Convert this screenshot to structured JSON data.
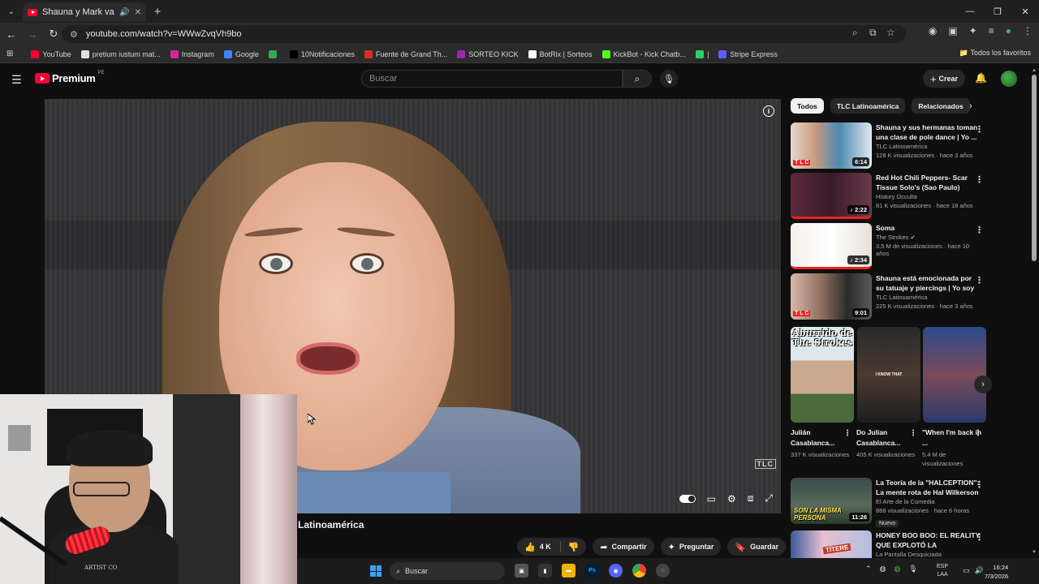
{
  "browser": {
    "tab_title": "Shauna y Mark van al gimn",
    "url": "youtube.com/watch?v=WWwZvqVh9bo",
    "bookmarks": [
      {
        "label": "YouTube",
        "color": "#ff0033"
      },
      {
        "label": "pretium iustum mat...",
        "color": "#e0e0e0"
      },
      {
        "label": "Instagram",
        "color": "#d6249f"
      },
      {
        "label": "Google",
        "color": "#4285f4"
      },
      {
        "label": "",
        "color": "#34a853"
      },
      {
        "label": "10Notificaciones",
        "color": "#000000"
      },
      {
        "label": "Fuente de Grand Th...",
        "color": "#d93025"
      },
      {
        "label": "SORTEO KICK",
        "color": "#9c27b0"
      },
      {
        "label": "BotRix | Sorteos",
        "color": "#ffffff"
      },
      {
        "label": "KickBot - Kick Chatb...",
        "color": "#53fc18"
      },
      {
        "label": "|",
        "color": "#25d366"
      },
      {
        "label": "Stripe Express",
        "color": "#635bff"
      }
    ],
    "all_bookmarks": "Todos los favoritos"
  },
  "header": {
    "logo_text": "Premium",
    "region": "PE",
    "search_placeholder": "Buscar",
    "create_label": "Crear"
  },
  "player": {
    "watermark": "TLC"
  },
  "video": {
    "channel_partial": "Latinoamérica",
    "likes": "4 K",
    "share": "Compartir",
    "ask": "Preguntar",
    "save": "Guardar"
  },
  "chips": [
    "Todos",
    "TLC Latinoamérica",
    "Relacionados"
  ],
  "recommendations": [
    {
      "title": "Shauna y sus hermanas toman una clase de pole dance | Yo ...",
      "channel": "TLC Latinoamérica",
      "stats": "128 K visualizaciones · hace 3 años",
      "duration": "6:14",
      "verified": false
    },
    {
      "title": "Red Hot Chili Peppers- Scar Tissue Solo's (Sao Paulo)",
      "channel": "History Occulta",
      "stats": "81 K visualizaciones · hace 18 años",
      "duration": "♪ 2:22",
      "verified": false
    },
    {
      "title": "Soma",
      "channel": "The Strokes",
      "stats": "3,5 M de visualizaciones · hace 10 años",
      "duration": "♪ 2:34",
      "verified": true
    },
    {
      "title": "Shauna está emocionada por su tatuaje y piercings | Yo soy ...",
      "channel": "TLC Latinoamérica",
      "stats": "225 K visualizaciones · hace 3 años",
      "duration": "9:01",
      "verified": false
    }
  ],
  "shorts": [
    {
      "title": "Julián Casablanca...",
      "views": "337 K visualizaciones",
      "overlay": "Aburrido de The Strokes"
    },
    {
      "title": "Do Julian Casablanca...",
      "views": "405 K visualizaciones",
      "overlay": "I KNOW THAT"
    },
    {
      "title": "\"When I'm back in ...",
      "views": "5,4 M de visualizaciones",
      "overlay": ""
    }
  ],
  "more_recs": [
    {
      "title": "La Teoría de la \"HALCEPTION\": La mente rota de Hal Wilkerson",
      "channel": "El Arte de la Comedia",
      "stats": "888 visualizaciones · hace 6 horas",
      "duration": "11:26",
      "badge": "Nuevo",
      "thumb_text": "SON LA MISMA PERSONA"
    },
    {
      "title": "HONEY BOO BOO: EL REALITY QUE EXPLOTÓ LA DESGRACIA...",
      "channel": "La Pantalla Desquiciada",
      "stats": "",
      "duration": "",
      "badge": "",
      "thumb_text": "TÍTERE"
    }
  ],
  "taskbar": {
    "search_label": "Buscar",
    "lang_line1": "ESP",
    "lang_line2": "LAA",
    "time": "16:24",
    "date": "7/3/2026"
  },
  "webcam": {
    "logo": "ARTIST CO"
  }
}
